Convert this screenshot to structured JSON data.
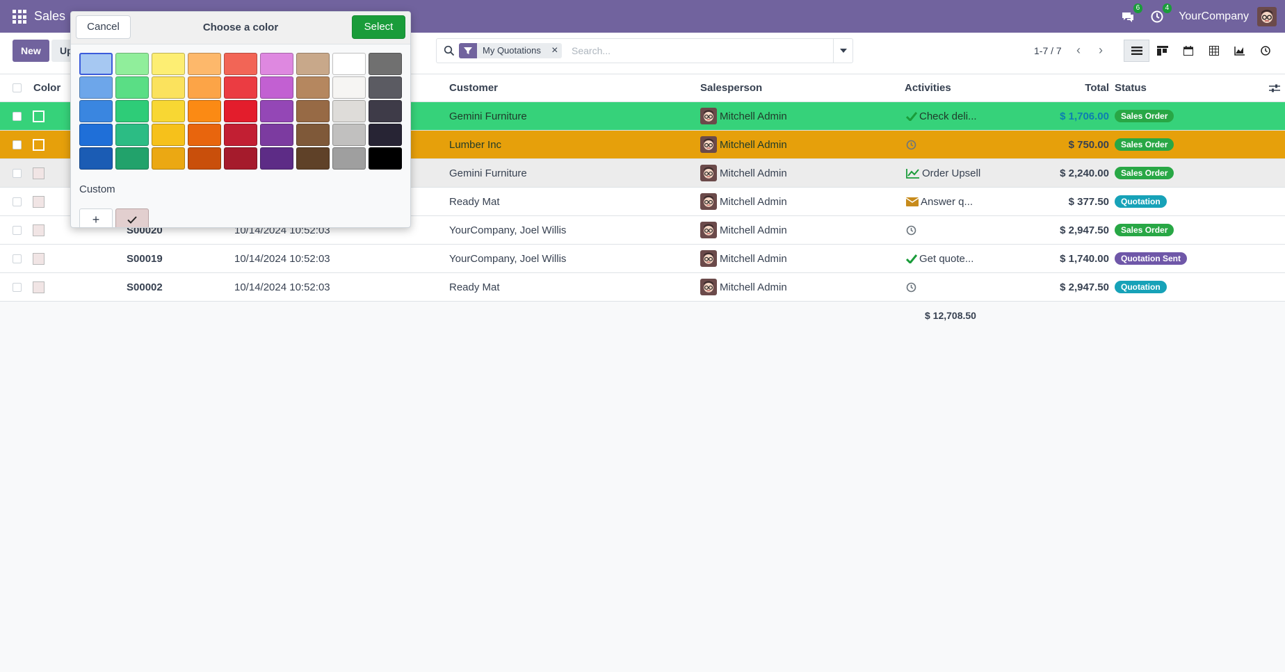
{
  "navbar": {
    "app_name": "Sales",
    "messages_count": "6",
    "activities_count": "4",
    "company": "YourCompany"
  },
  "control_panel": {
    "new_label": "New",
    "upload_label": "Upload",
    "facet_label": "My Quotations",
    "search_placeholder": "Search...",
    "pager": "1-7 / 7"
  },
  "table": {
    "headers": {
      "color": "Color",
      "customer": "Customer",
      "salesperson": "Salesperson",
      "activities": "Activities",
      "total": "Total",
      "status": "Status"
    },
    "rows": [
      {
        "number": "",
        "date": "",
        "customer": "Gemini Furniture",
        "salesperson": "Mitchell Admin",
        "activity": "Check deli...",
        "activity_icon": "check-icon",
        "total": "$ 1,706.00",
        "status": "Sales Order",
        "status_type": "so",
        "row_color": "#36d27a",
        "swatch": "#36d27a"
      },
      {
        "number": "",
        "date": "",
        "customer": "Lumber Inc",
        "salesperson": "Mitchell Admin",
        "activity": "",
        "activity_icon": "clock-icon",
        "total": "$ 750.00",
        "status": "Sales Order",
        "status_type": "so",
        "row_color": "#e6a00b",
        "swatch": "#e6a00b"
      },
      {
        "number": "",
        "date": "",
        "customer": "Gemini Furniture",
        "salesperson": "Mitchell Admin",
        "activity": "Order Upsell",
        "activity_icon": "chart-line-icon",
        "total": "$ 2,240.00",
        "status": "Sales Order",
        "status_type": "so",
        "row_color": "#ececec",
        "swatch": ""
      },
      {
        "number": "",
        "date": "",
        "customer": "Ready Mat",
        "salesperson": "Mitchell Admin",
        "activity": "Answer q...",
        "activity_icon": "envelope-icon",
        "total": "$ 377.50",
        "status": "Quotation",
        "status_type": "q",
        "row_color": "#ffffff",
        "swatch": ""
      },
      {
        "number": "S00020",
        "date": "10/14/2024 10:52:03",
        "customer": "YourCompany, Joel Willis",
        "salesperson": "Mitchell Admin",
        "activity": "",
        "activity_icon": "clock-icon",
        "total": "$ 2,947.50",
        "status": "Sales Order",
        "status_type": "so",
        "row_color": "#ffffff",
        "swatch": ""
      },
      {
        "number": "S00019",
        "date": "10/14/2024 10:52:03",
        "customer": "YourCompany, Joel Willis",
        "salesperson": "Mitchell Admin",
        "activity": "Get quote...",
        "activity_icon": "check-icon",
        "total": "$ 1,740.00",
        "status": "Quotation Sent",
        "status_type": "qs",
        "row_color": "#ffffff",
        "swatch": ""
      },
      {
        "number": "S00002",
        "date": "10/14/2024 10:52:03",
        "customer": "Ready Mat",
        "salesperson": "Mitchell Admin",
        "activity": "",
        "activity_icon": "clock-icon",
        "total": "$ 2,947.50",
        "status": "Quotation",
        "status_type": "q",
        "row_color": "#ffffff",
        "swatch": ""
      }
    ],
    "grand_total": "$ 12,708.50"
  },
  "color_picker": {
    "cancel_label": "Cancel",
    "title": "Choose a color",
    "select_label": "Select",
    "custom_label": "Custom",
    "add_custom_symbol": "+",
    "selected_index": 0,
    "palette": [
      "#a6c8f2",
      "#90ee9b",
      "#fdee73",
      "#fdb86b",
      "#f26556",
      "#de88e0",
      "#c8a88a",
      "#ffffff",
      "#707070",
      "#6da6ea",
      "#5ade85",
      "#fbe25d",
      "#fca447",
      "#eb3c42",
      "#c260d2",
      "#b5875f",
      "#f6f5f3",
      "#5b5b62",
      "#3a86e0",
      "#2ecc78",
      "#f8d733",
      "#fb8a14",
      "#e31d2c",
      "#9447b6",
      "#976a45",
      "#dedcd9",
      "#3e3b48",
      "#1f6fd8",
      "#2cbc84",
      "#f6c11b",
      "#e8650d",
      "#c21f33",
      "#7c3ba0",
      "#7f5939",
      "#c1c0bf",
      "#272434",
      "#1b5cb4",
      "#22a26b",
      "#eba813",
      "#c94f0b",
      "#a51b2c",
      "#5d2c86",
      "#5f4128",
      "#9f9f9f",
      "#000000"
    ]
  }
}
